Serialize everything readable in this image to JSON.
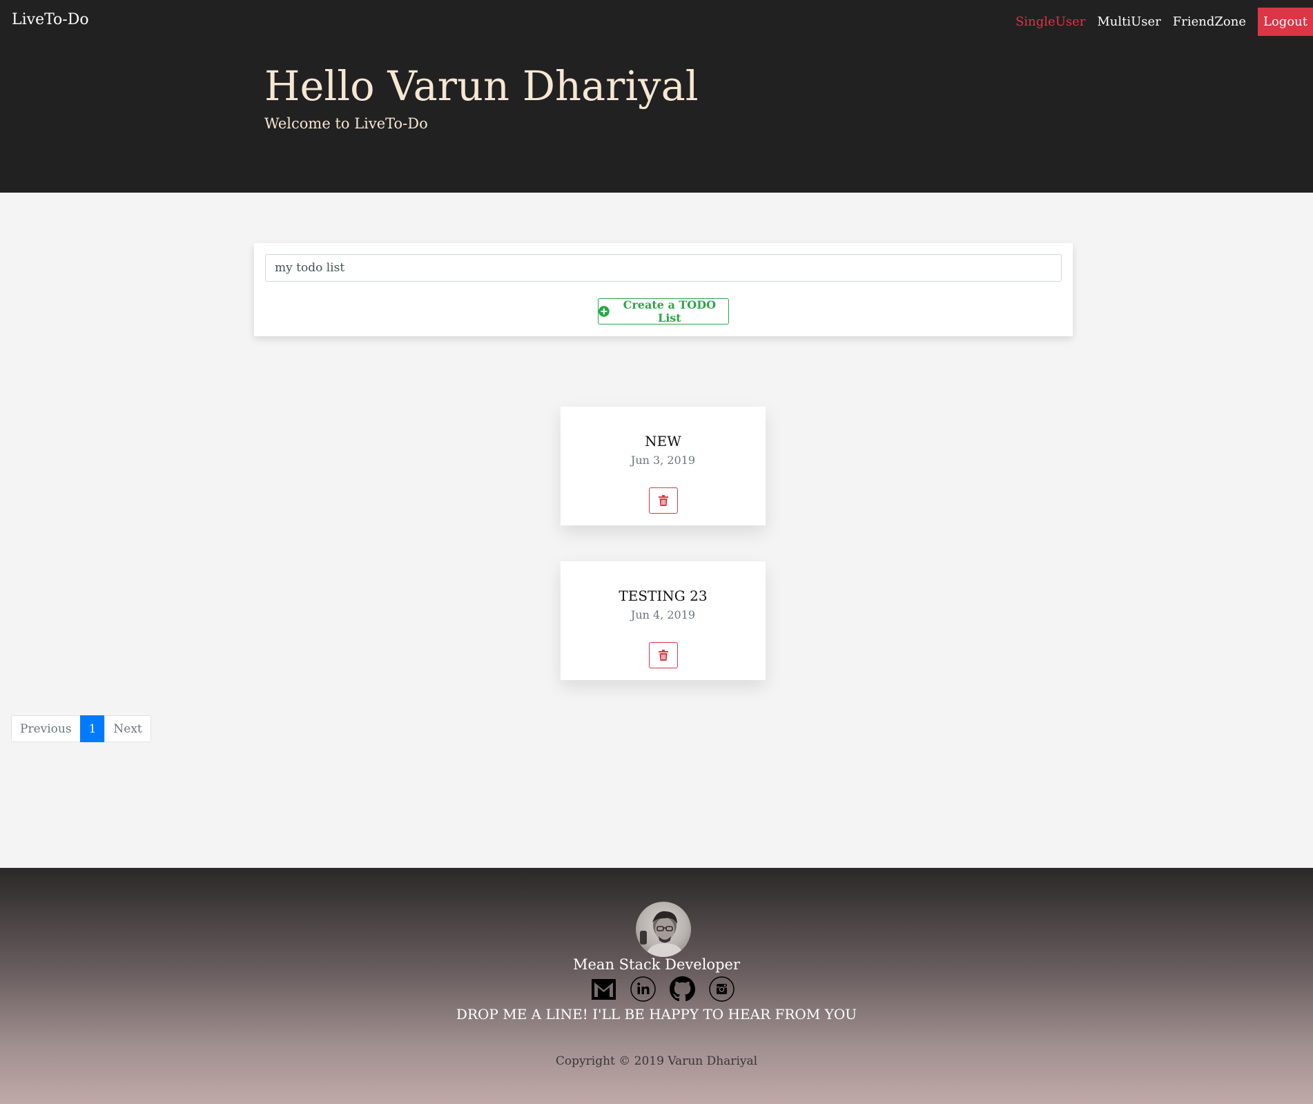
{
  "header": {
    "brand": "LiveTo-Do",
    "nav": [
      {
        "label": "SingleUser",
        "active": true
      },
      {
        "label": "MultiUser",
        "active": false
      },
      {
        "label": "FriendZone",
        "active": false
      }
    ],
    "logout_label": "Logout",
    "greeting": "Hello Varun Dhariyal",
    "subtitle": "Welcome to LiveTo-Do"
  },
  "create": {
    "input_value": "my todo list",
    "button_label": "Create a TODO List",
    "button_icon": "plus-circle-icon"
  },
  "lists": [
    {
      "title": "NEW",
      "date": "Jun 3, 2019",
      "delete_icon": "trash-icon"
    },
    {
      "title": "TESTING 23",
      "date": "Jun 4, 2019",
      "delete_icon": "trash-icon"
    }
  ],
  "pagination": {
    "previous": "Previous",
    "current": "1",
    "next": "Next"
  },
  "footer": {
    "role": "Mean Stack Developer",
    "social": [
      "gmail-icon",
      "linkedin-icon",
      "github-icon",
      "instagram-icon"
    ],
    "cta": "DROP ME A LINE! I'LL BE HAPPY TO HEAR FROM YOU",
    "copyright": "Copyright © 2019 Varun Dhariyal"
  },
  "colors": {
    "header_bg": "#222122",
    "hero_text": "#f6e7d3",
    "danger": "#dc3545",
    "success": "#28a745",
    "primary": "#007bff"
  }
}
